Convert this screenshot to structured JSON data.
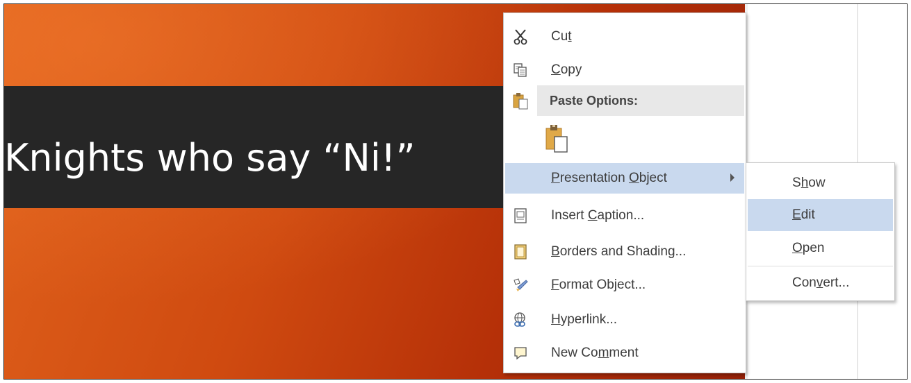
{
  "slide": {
    "title": "Knights who say “Ni!”"
  },
  "context_menu": {
    "items": [
      {
        "pre": "Cu",
        "ul": "t",
        "post": "",
        "icon": "scissors-icon"
      },
      {
        "pre": "",
        "ul": "C",
        "post": "opy",
        "icon": "copy-icon"
      },
      {
        "pre": "",
        "ul": "P",
        "post": "resentation ",
        "ul2": "O",
        "post2": "bject",
        "icon": "none"
      },
      {
        "pre": "Insert ",
        "ul": "C",
        "post": "aption...",
        "icon": "caption-icon"
      },
      {
        "pre": "",
        "ul": "B",
        "post": "orders and Shading...",
        "icon": "borders-icon"
      },
      {
        "pre": "",
        "ul": "F",
        "post": "ormat Object...",
        "icon": "format-object-icon"
      },
      {
        "pre": "",
        "ul": "H",
        "post": "yperlink...",
        "icon": "hyperlink-icon"
      },
      {
        "pre": "New Co",
        "ul": "m",
        "post": "ment",
        "icon": "comment-icon"
      }
    ],
    "paste_header": "Paste Options:",
    "paste_icon": "paste-keep-formatting-icon"
  },
  "submenu": {
    "items": [
      {
        "pre": "S",
        "ul": "h",
        "post": "ow"
      },
      {
        "pre": "",
        "ul": "E",
        "post": "dit"
      },
      {
        "pre": "",
        "ul": "O",
        "post": "pen"
      },
      {
        "pre": "Con",
        "ul": "v",
        "post": "ert..."
      }
    ]
  },
  "colors": {
    "highlight": "#c9d9ee",
    "title_bar": "#262626",
    "slide_orange": "#d24e12"
  }
}
